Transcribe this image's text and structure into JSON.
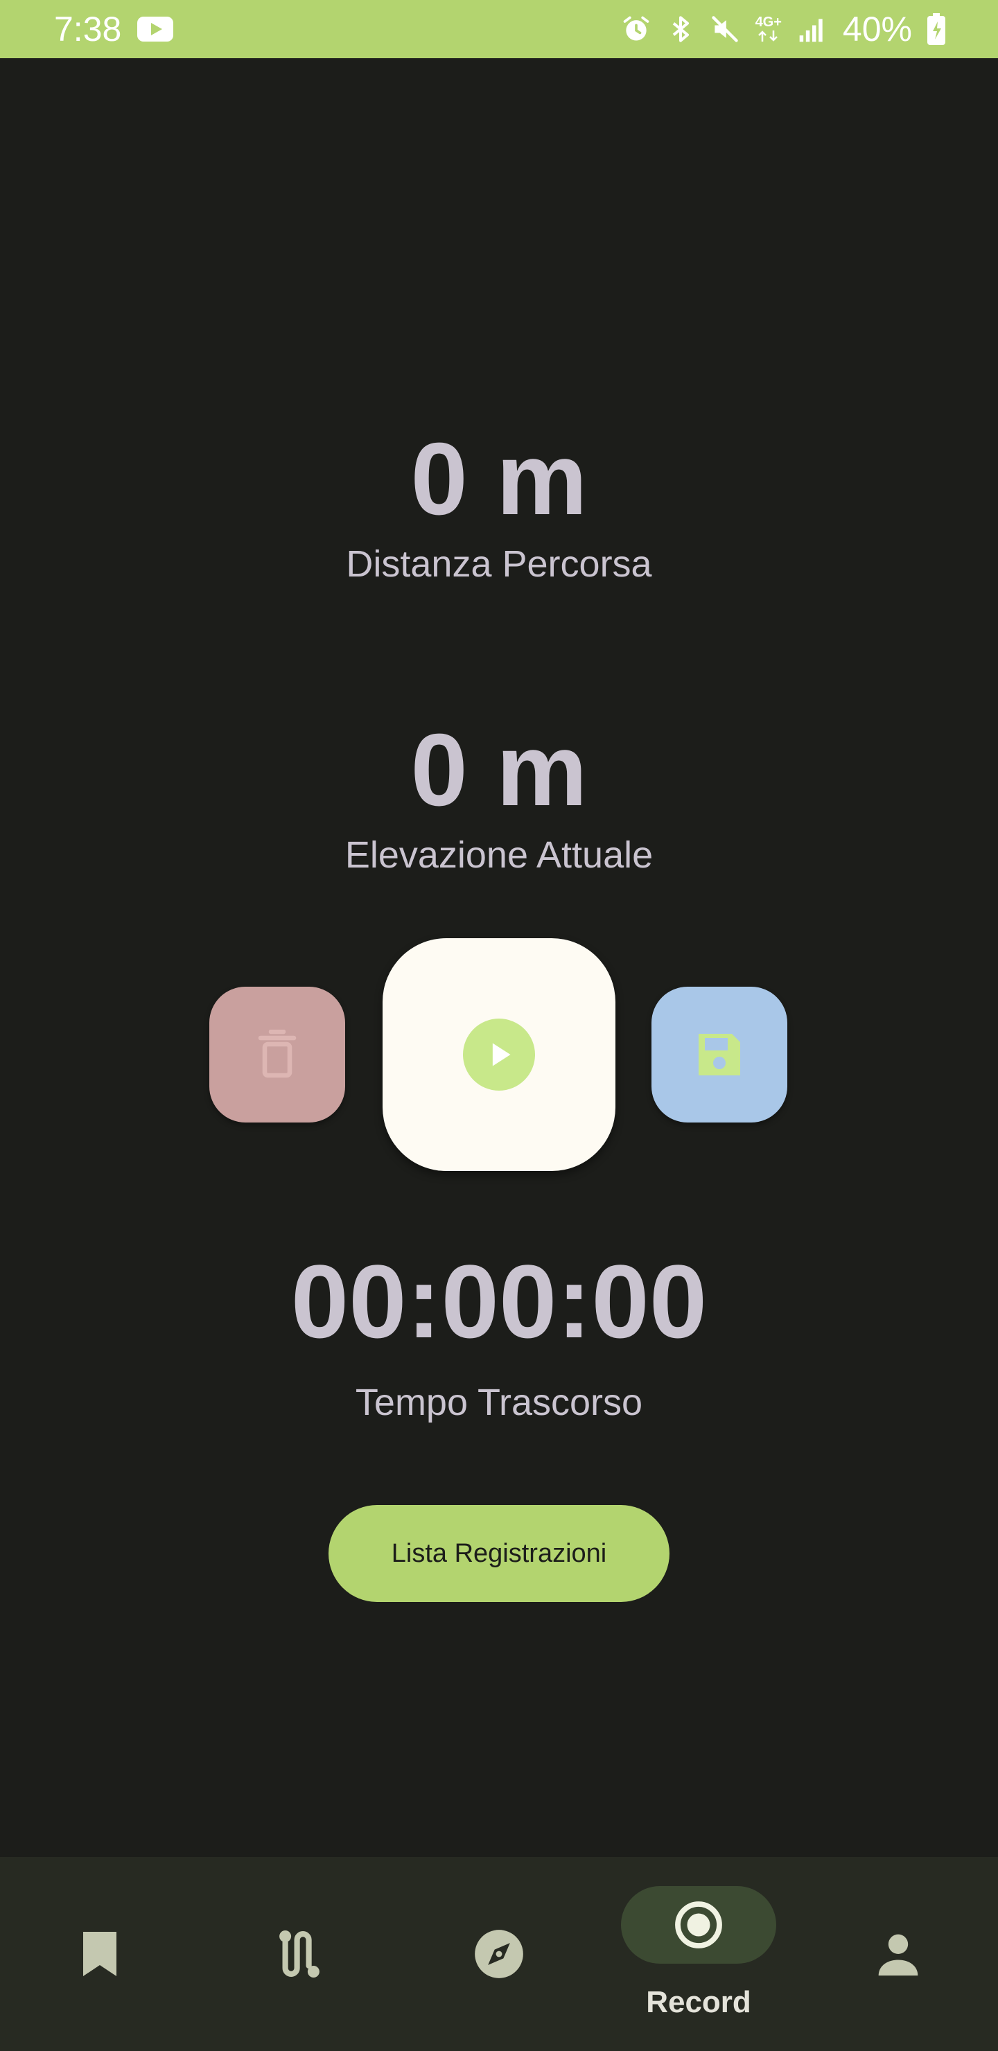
{
  "status_bar": {
    "time": "7:38",
    "network": "4G+",
    "battery": "40%"
  },
  "distance": {
    "value": "0 m",
    "label": "Distanza Percorsa"
  },
  "elevation": {
    "value": "0 m",
    "label": "Elevazione Attuale"
  },
  "timer": {
    "value": "00:00:00",
    "label": "Tempo Trascorso"
  },
  "actions": {
    "delete_icon": "trash-icon",
    "play_icon": "play-icon",
    "save_icon": "floppy-disk-icon"
  },
  "list_button": {
    "label": "Lista Registrazioni"
  },
  "bottom_nav": {
    "items": [
      {
        "icon": "bookmark-icon",
        "label": ""
      },
      {
        "icon": "route-icon",
        "label": ""
      },
      {
        "icon": "compass-icon",
        "label": ""
      },
      {
        "icon": "record-icon",
        "label": "Record",
        "active": true
      },
      {
        "icon": "person-icon",
        "label": ""
      }
    ]
  },
  "colors": {
    "background": "#1c1d1a",
    "accent": "#b3d46f",
    "text": "#cac4d0",
    "delete": "#c9a09e",
    "save": "#a9c7e8",
    "play_bg": "#fefbf3",
    "nav_bg": "#272a22"
  }
}
